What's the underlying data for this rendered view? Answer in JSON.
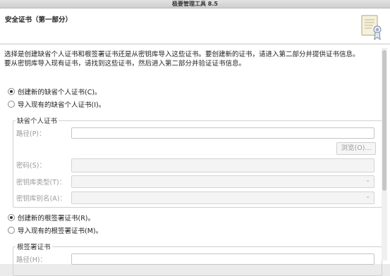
{
  "window": {
    "title": "极要管理工具 8.5"
  },
  "header": {
    "title": "安全证书（第一部分）",
    "icon": "certificate-wizard-icon"
  },
  "intro": {
    "line1": "选择是创建缺省个人证书和根签署证书还是从密钥库导入这些证书。要创建新的证书，请进入第二部分并提供证书信息。",
    "line2": "要从密钥库导入现有证书，请找到这些证书，然后进入第二部分并验证证书信息。"
  },
  "personal": {
    "create_label": "创建新的缺省个人证书(C)。",
    "create_selected": true,
    "import_label": "导入现有的缺省个人证书(I)。",
    "import_selected": false,
    "group_title": "缺省个人证书",
    "path_label": "路径(P)：",
    "path_value": "",
    "browse_label": "浏览(O)...",
    "password_label": "密码(S)：",
    "password_value": "",
    "keystore_type_label": "密钥库类型(T)：",
    "keystore_type_value": "",
    "keystore_alias_label": "密钥库别名(A)：",
    "keystore_alias_value": ""
  },
  "root": {
    "create_label": "创建新的根签署证书(R)。",
    "create_selected": true,
    "import_label": "导入现有的根签署证书(M)。",
    "import_selected": false,
    "group_title": "根签署证书",
    "path_label": "路径(H)："
  }
}
